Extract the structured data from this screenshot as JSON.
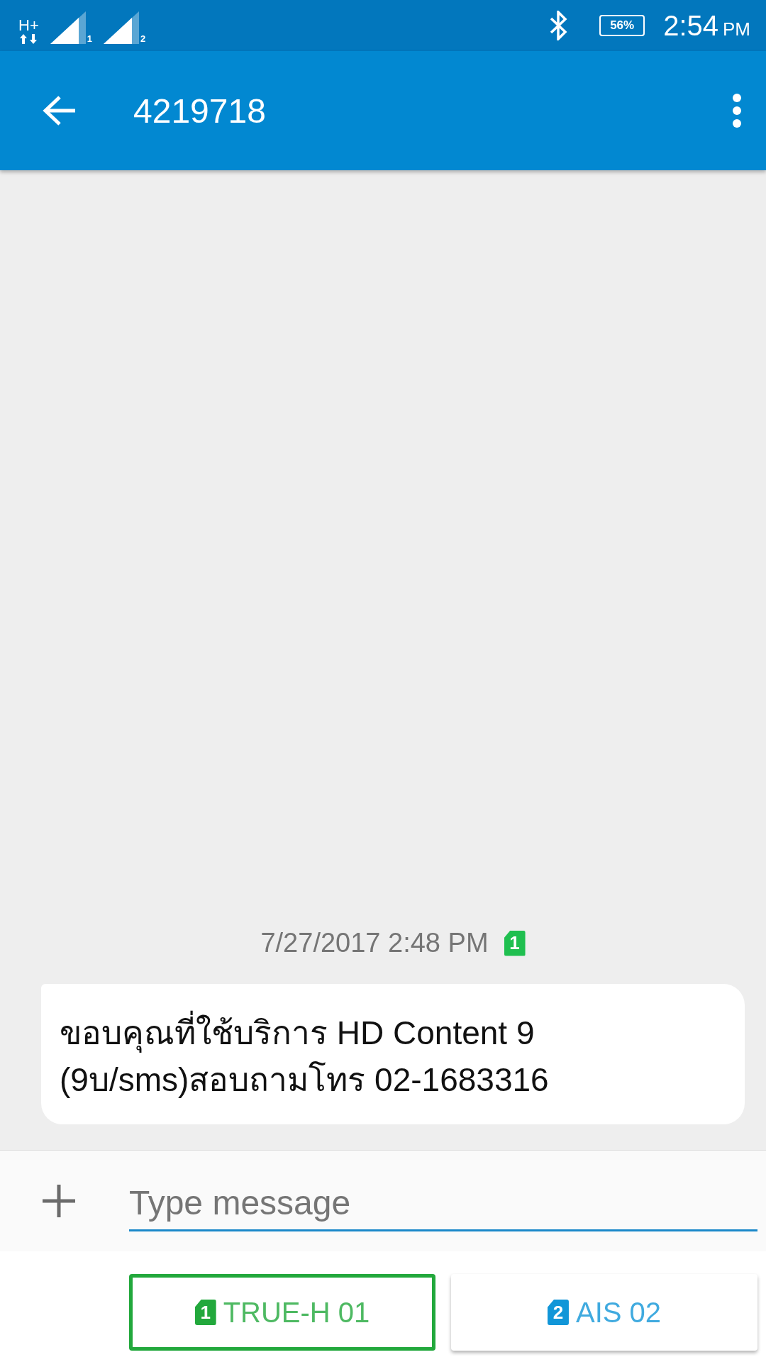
{
  "status_bar": {
    "network_type": "H+",
    "sim_signals": [
      {
        "label": "1"
      },
      {
        "label": "2"
      }
    ],
    "battery": "56%",
    "time": "2:54",
    "time_suffix": "PM"
  },
  "app_bar": {
    "title": "4219718"
  },
  "messages": [
    {
      "timestamp": "7/27/2017 2:48 PM",
      "sim": "1",
      "color": "#1fbf4f",
      "text": "ขอบคุณที่ใช้บริการ HD Content 9 (9บ/sms)สอบถามโทร 02-1683316"
    }
  ],
  "composer": {
    "placeholder": "Type message"
  },
  "sim_buttons": [
    {
      "sim": "1",
      "label": "TRUE-H 01",
      "color": "#22a83c",
      "selected": true
    },
    {
      "sim": "2",
      "label": "AIS 02",
      "color": "#1196d8",
      "selected": false
    }
  ]
}
